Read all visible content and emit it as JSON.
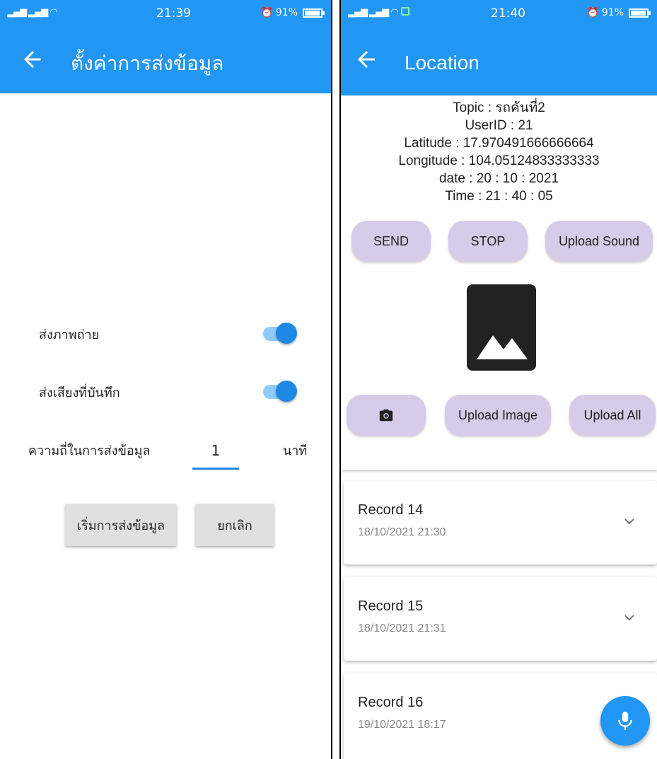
{
  "left": {
    "status": {
      "time": "21:39",
      "battery": "91%"
    },
    "appbar": {
      "title": "ตั้งค่าการส่งข้อมูล"
    },
    "settings": {
      "photo_label": "ส่งภาพถ่าย",
      "photo_on": true,
      "audio_label": "ส่งเสียงที่บันทึก",
      "audio_on": true,
      "frequency_label": "ความถี่ในการส่งข้อมูล",
      "frequency_value": "1",
      "frequency_unit": "นาที"
    },
    "buttons": {
      "start": "เริ่มการส่งข้อมูล",
      "cancel": "ยกเลิก"
    }
  },
  "right": {
    "status": {
      "time": "21:40",
      "battery": "91%"
    },
    "appbar": {
      "title": "Location"
    },
    "info": {
      "topic": "Topic : รถคันที่2",
      "user_id": "UserID : 21",
      "latitude": "Latitude : 17.970491666666664",
      "longitude": "Longitude : 104.05124833333333",
      "date": "date : 20 : 10 : 2021",
      "time": "Time : 21 : 40 : 05"
    },
    "buttons": {
      "send": "SEND",
      "stop": "STOP",
      "upload_sound": "Upload Sound",
      "upload_image": "Upload Image",
      "upload_all": "Upload All"
    },
    "records": [
      {
        "title": "Record 14",
        "date": "18/10/2021 21:30"
      },
      {
        "title": "Record 15",
        "date": "18/10/2021 21:31"
      },
      {
        "title": "Record 16",
        "date": "19/10/2021 18:17"
      }
    ]
  }
}
